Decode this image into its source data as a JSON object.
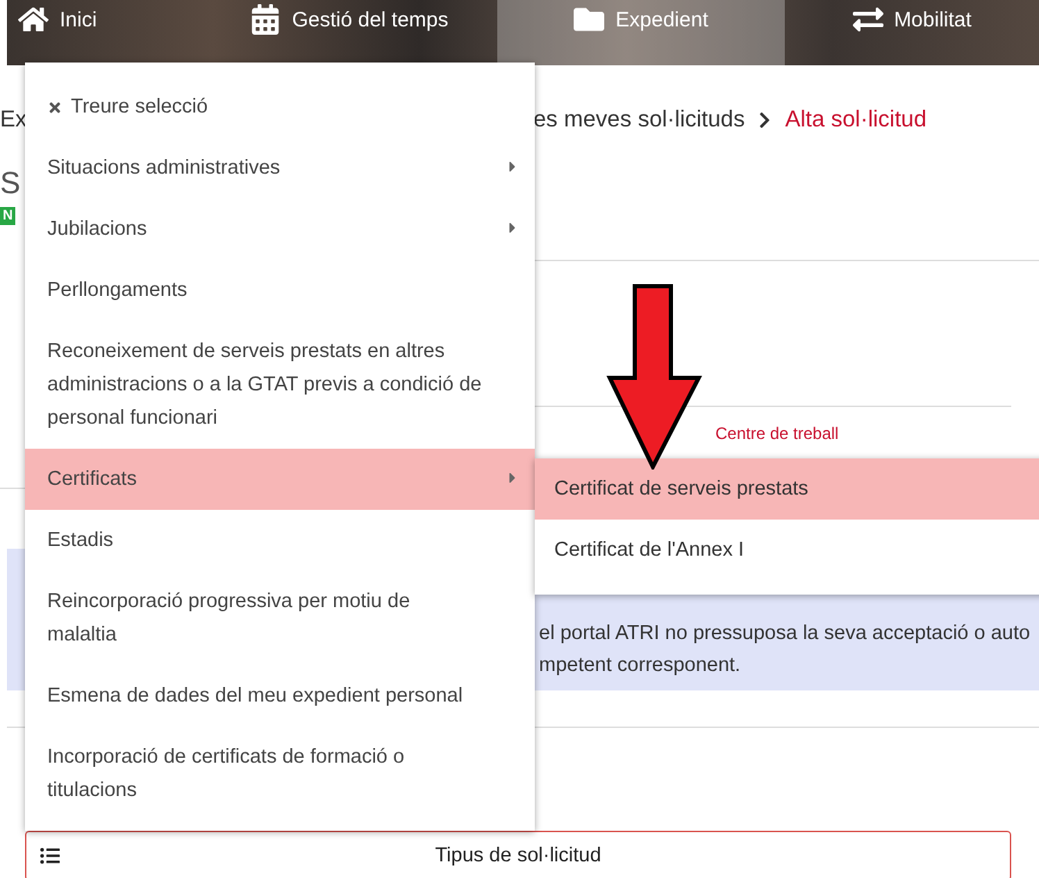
{
  "nav": [
    {
      "label": "Inici",
      "selected": false
    },
    {
      "label": "Gestió del temps",
      "selected": false
    },
    {
      "label": "Expedient",
      "selected": true
    },
    {
      "label": "Mobilitat",
      "selected": false
    }
  ],
  "breadcrumb": {
    "start": "Ex",
    "items": [
      {
        "label": "es meves sol·licituds",
        "current": false
      },
      {
        "label": "Alta sol·licitud",
        "current": true
      }
    ]
  },
  "title": "S",
  "badge": "N",
  "field_label": "Centre de treball",
  "notice": [
    "el portal ATRI no pressuposa la seva acceptació o auto",
    "mpetent corresponent."
  ],
  "select": {
    "label": "Tipus de sol·licitud"
  },
  "menu": {
    "clear": "Treure selecció",
    "items": [
      {
        "label": "Situacions administratives",
        "has_submenu": true,
        "selected": false
      },
      {
        "label": "Jubilacions",
        "has_submenu": true,
        "selected": false
      },
      {
        "label": "Perllongaments",
        "has_submenu": false,
        "selected": false
      },
      {
        "label": "Reconeixement de serveis prestats en altres administracions o a la GTAT previs a condició de personal funcionari",
        "has_submenu": false,
        "selected": false
      },
      {
        "label": "Certificats",
        "has_submenu": true,
        "selected": true
      },
      {
        "label": "Estadis",
        "has_submenu": false,
        "selected": false
      },
      {
        "label": "Reincorporació progressiva per motiu de malaltia",
        "has_submenu": false,
        "selected": false
      },
      {
        "label": "Esmena de dades del meu expedient personal",
        "has_submenu": false,
        "selected": false
      },
      {
        "label": "Incorporació de certificats de formació o titulacions",
        "has_submenu": false,
        "selected": false
      }
    ]
  },
  "submenu": [
    {
      "label": "Certificat de serveis prestats",
      "selected": true
    },
    {
      "label": "Certificat de l'Annex I",
      "selected": false
    }
  ]
}
